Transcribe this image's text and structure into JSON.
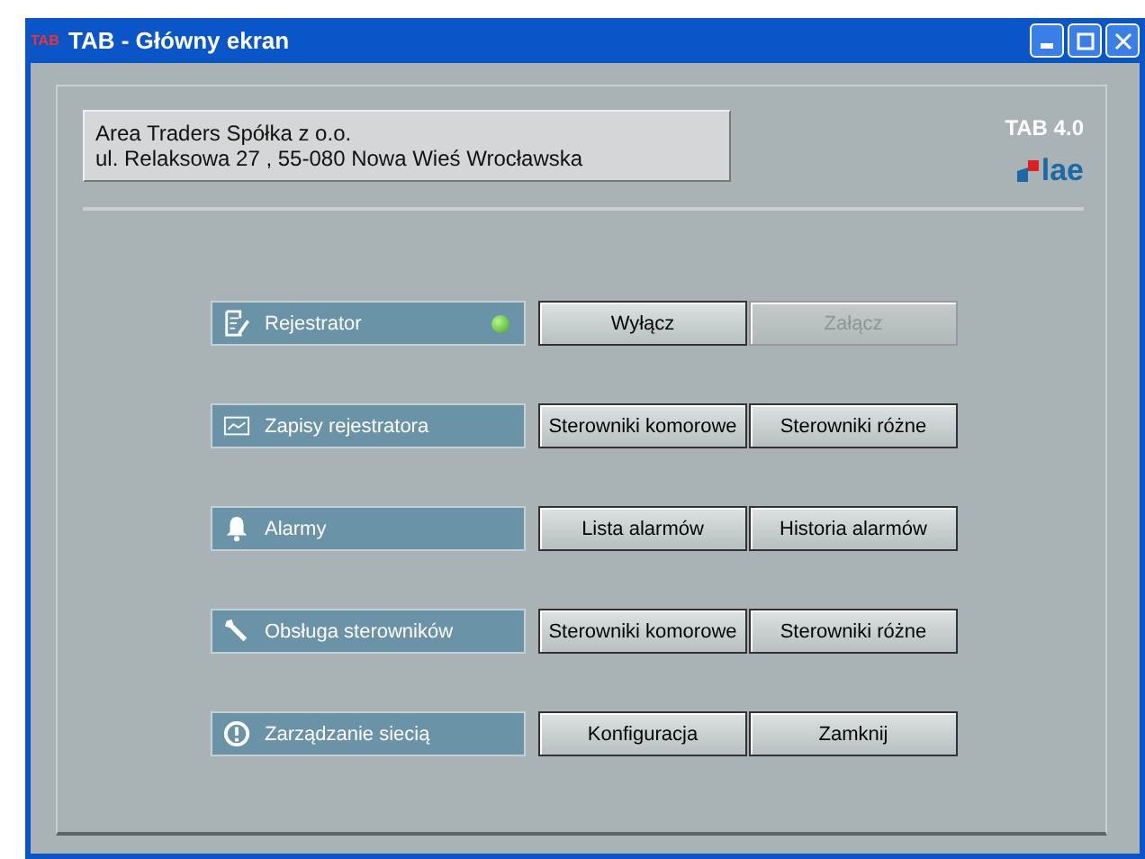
{
  "window": {
    "title": "TAB - Główny ekran",
    "app_badge": "TAB"
  },
  "header": {
    "company_lines": [
      "Area Traders Spółka z o.o.",
      "ul. Relaksowa 27 , 55-080 Nowa Wieś Wrocławska"
    ],
    "version": "TAB 4.0",
    "logo": "lae"
  },
  "rows": [
    {
      "label": "Rejestrator",
      "status_on": true,
      "buttons": [
        {
          "label": "Wyłącz",
          "disabled": false
        },
        {
          "label": "Załącz",
          "disabled": true
        }
      ]
    },
    {
      "label": "Zapisy rejestratora",
      "buttons": [
        {
          "label": "Sterowniki komorowe",
          "disabled": false
        },
        {
          "label": "Sterowniki różne",
          "disabled": false
        }
      ]
    },
    {
      "label": "Alarmy",
      "buttons": [
        {
          "label": "Lista alarmów",
          "disabled": false
        },
        {
          "label": "Historia alarmów",
          "disabled": false
        }
      ]
    },
    {
      "label": "Obsługa sterowników",
      "buttons": [
        {
          "label": "Sterowniki komorowe",
          "disabled": false
        },
        {
          "label": "Sterowniki różne",
          "disabled": false
        }
      ]
    },
    {
      "label": "Zarządzanie siecią",
      "buttons": [
        {
          "label": "Konfiguracja",
          "disabled": false
        },
        {
          "label": "Zamknij",
          "disabled": false
        }
      ]
    }
  ]
}
